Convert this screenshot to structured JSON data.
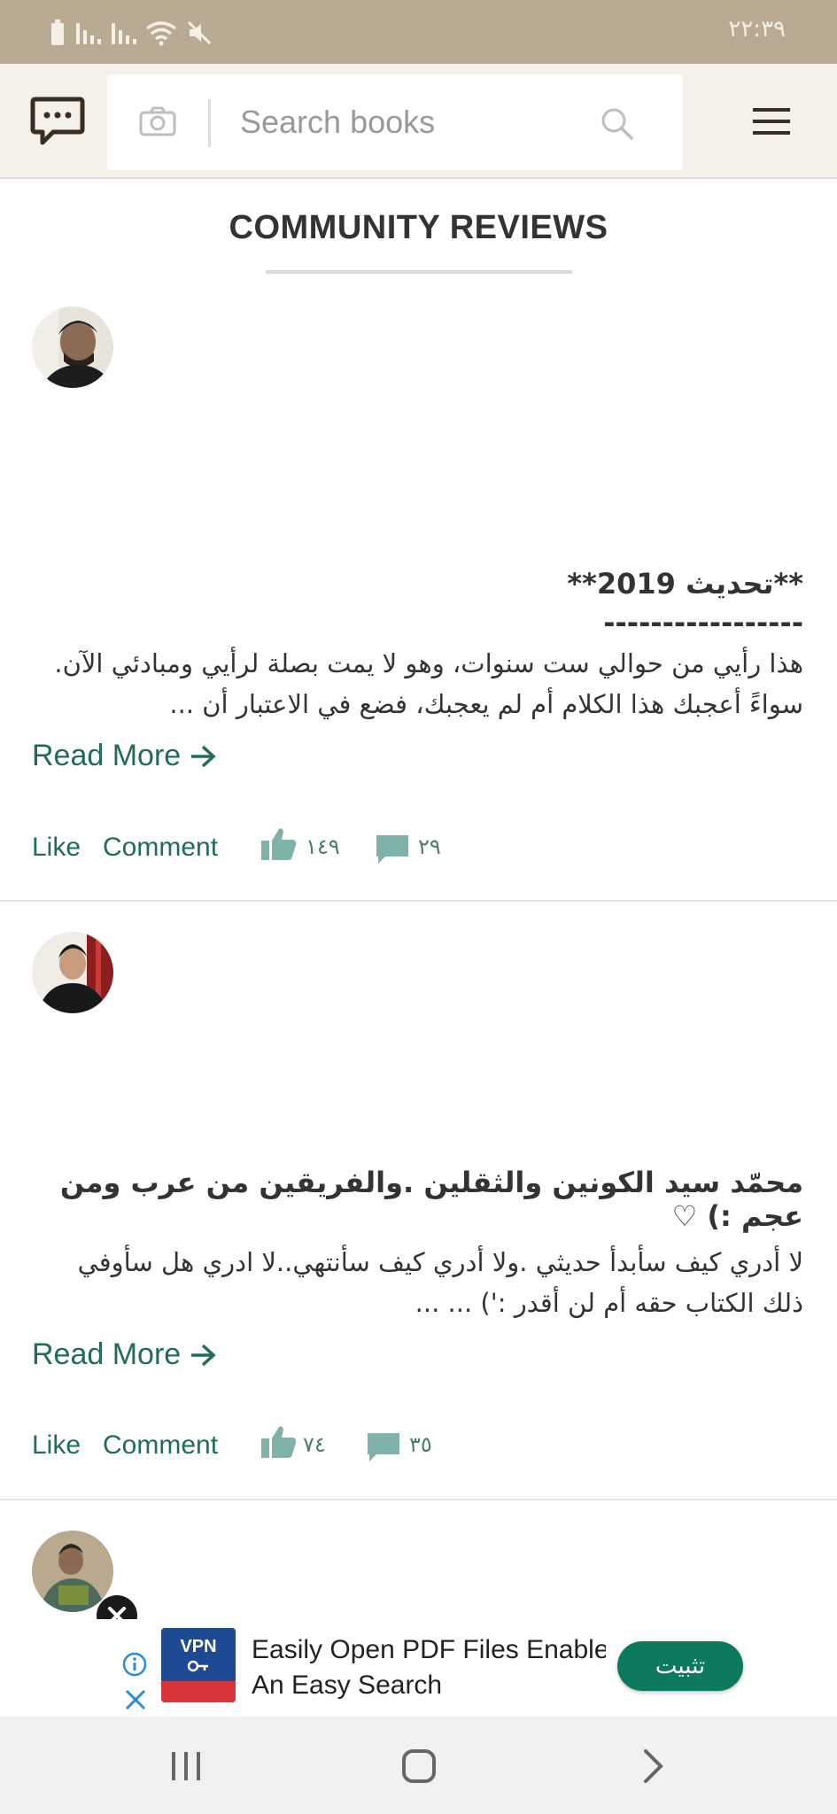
{
  "status_bar": {
    "time": "٢٢:٣٩"
  },
  "header": {
    "search_placeholder": "Search books"
  },
  "section_title": "COMMUNITY REVIEWS",
  "reviews": [
    {
      "heading": "**تحديث 2019**",
      "dashes": "-----------------",
      "body": "هذا رأيي من حوالي ست سنوات، وهو لا يمت بصلة لرأيي ومبادئي الآن. سواءً أعجبك هذا الكلام أم لم يعجبك، فضع في الاعتبار أن ...",
      "read_more": "Read More",
      "like_label": "Like",
      "comment_label": "Comment",
      "likes_count": "١٤٩",
      "comments_count": "٢٩"
    },
    {
      "heading": "محمّد سيد الكونين والثقلين .والفريقين من عرب ومن عجم :) ♡",
      "body": "لا أدري كيف سأبدأ حديثي .ولا أدري كيف سأنتهي..لا ادري هل سأوفي ذلك الكتاب حقه أم لن أقدر :') ... ...",
      "read_more": "Read More",
      "like_label": "Like",
      "comment_label": "Comment",
      "likes_count": "٧٤",
      "comments_count": "٣٥"
    }
  ],
  "ad": {
    "logo_text": "VPN",
    "line1": "Easily Open PDF Files Enables",
    "line2": "An Easy Search",
    "install_label": "تثبيت"
  },
  "colors": {
    "status_bar": "#b9ab93",
    "header_bg": "#f4f1ea",
    "accent_teal": "#1f6b5c",
    "icon_teal": "#7fb3aa",
    "install_green": "#0d7a5f"
  }
}
